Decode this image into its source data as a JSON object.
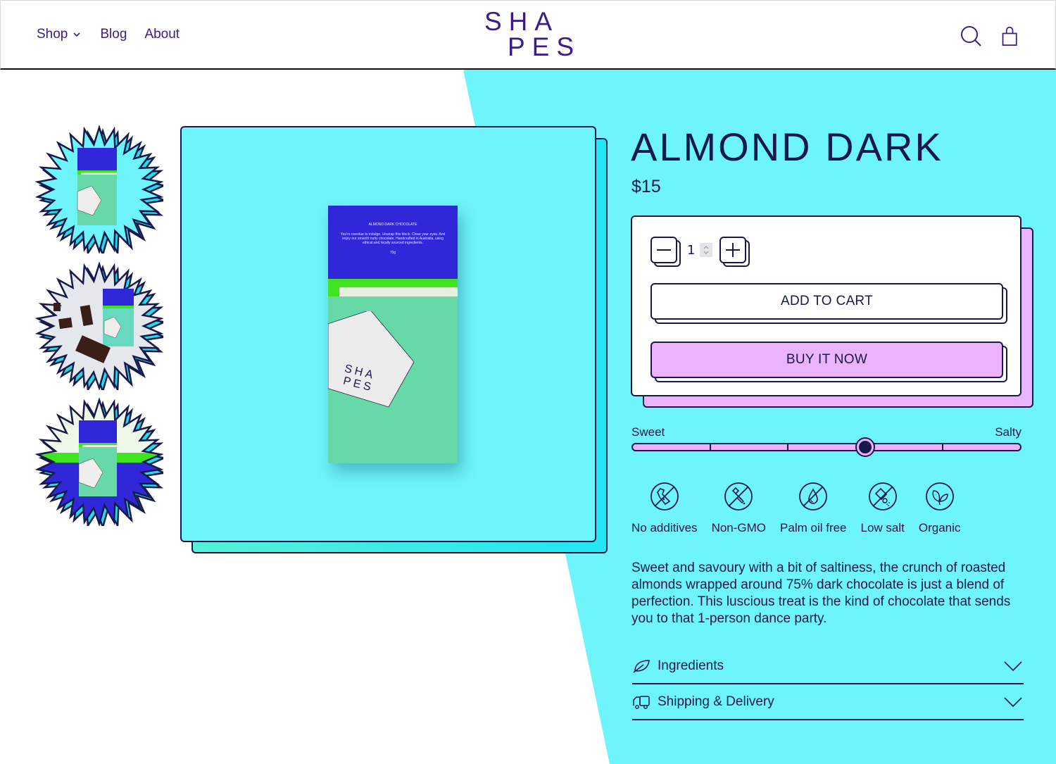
{
  "header": {
    "nav": [
      {
        "label": "Shop",
        "has_dropdown": true
      },
      {
        "label": "Blog"
      },
      {
        "label": "About"
      }
    ],
    "logo": {
      "line1": "SHA",
      "line2": "PES"
    },
    "icons": [
      "search-icon",
      "shopping-bag-icon"
    ]
  },
  "colors": {
    "brand_purple": "#3a1d8a",
    "ink": "#16194a",
    "cyan": "#6ef4fb",
    "pink": "#eab3fb",
    "bar_blue": "#2f27d8",
    "bar_green": "#3fe31e",
    "bar_mint": "#67d9a8"
  },
  "gallery": {
    "thumbnails": [
      {
        "alt": "Almond Dark bar on cyan background"
      },
      {
        "alt": "Almond Dark bar with chocolate pieces"
      },
      {
        "alt": "Almond Dark bar on green and blue background"
      }
    ],
    "main_image": {
      "package_title": "ALMOND DARK CHOCOLATE",
      "package_text": "You're overdue to indulge. Unwrap this block. Close your eyes. And enjoy our smooth nutty chocolate. Handcrafted in Australia, using ethical and locally sourced ingredients.",
      "package_weight": "70g",
      "package_logo_line1": "SHA",
      "package_logo_line2": "PES"
    }
  },
  "product": {
    "title": "ALMOND DARK",
    "price": "$15",
    "quantity": "1",
    "add_to_cart_label": "ADD TO CART",
    "buy_now_label": "BUY IT NOW",
    "taste_scale": {
      "left_label": "Sweet",
      "right_label": "Salty",
      "segments": 5,
      "value_fraction": 0.6
    },
    "features": [
      {
        "label": "No additives",
        "icon": "no-additives-icon"
      },
      {
        "label": "Non-GMO",
        "icon": "non-gmo-icon"
      },
      {
        "label": "Palm oil free",
        "icon": "palm-oil-free-icon"
      },
      {
        "label": "Low salt",
        "icon": "low-salt-icon"
      },
      {
        "label": "Organic",
        "icon": "organic-icon"
      }
    ],
    "description": "Sweet and savoury with a bit of saltiness, the crunch of roasted almonds wrapped around 75% dark chocolate is just a blend of perfection. This luscious treat is the kind of chocolate that sends you to that 1-person dance party.",
    "accordions": [
      {
        "label": "Ingredients",
        "icon": "leaf-icon"
      },
      {
        "label": "Shipping & Delivery",
        "icon": "truck-icon"
      }
    ]
  }
}
